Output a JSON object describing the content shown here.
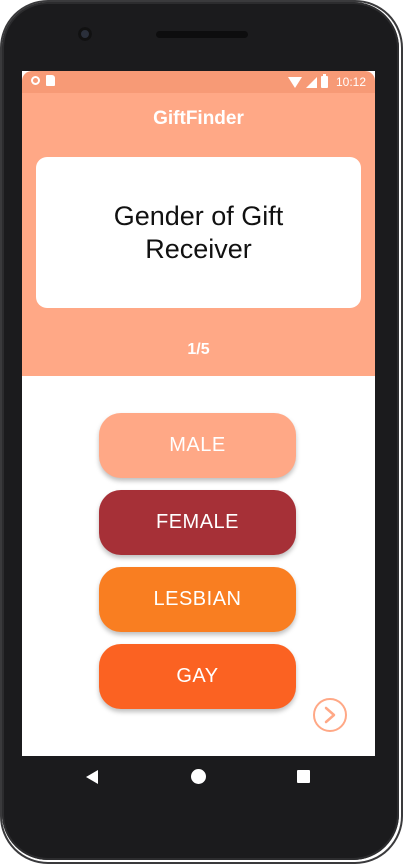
{
  "status": {
    "time": "10:12"
  },
  "app": {
    "title": "GiftFinder"
  },
  "question": {
    "text": "Gender of Gift Receiver",
    "progress": "1/5"
  },
  "options": [
    {
      "label": "MALE",
      "color": "#ffa886"
    },
    {
      "label": "FEMALE",
      "color": "#a63037"
    },
    {
      "label": "LESBIAN",
      "color": "#f97e21"
    },
    {
      "label": "GAY",
      "color": "#fb6222"
    }
  ],
  "icons": {
    "next": "chevron-right-circle-icon",
    "nav_back": "back-triangle-icon",
    "nav_home": "home-circle-icon",
    "nav_recent": "recent-apps-square-icon"
  },
  "colors": {
    "header": "#ffa886",
    "status_bar": "#f79a76"
  }
}
